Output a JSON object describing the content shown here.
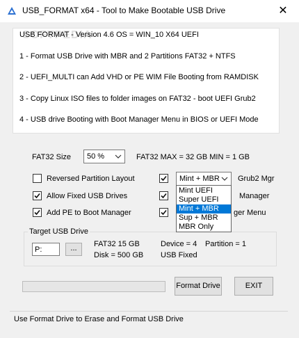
{
  "window": {
    "title": "USB_FORMAT x64 - Tool to Make Bootable USB Drive",
    "close_glyph": "✕"
  },
  "watermark": "SOFTPEDIA",
  "info": {
    "version_line": "USB FORMAT - Version 4.6    OS = WIN_10 X64  UEFI",
    "line1": "1 - Format USB Drive with MBR and 2 Partitions FAT32 + NTFS",
    "line2": "2 - UEFI_MULTI can Add VHD or PE WIM File Booting from RAMDISK",
    "line3": "3 - Copy Linux ISO files to folder images on FAT32 - boot UEFI Grub2",
    "line4": "4 - USB drive Booting with Boot Manager Menu in BIOS or UEFI Mode"
  },
  "fat32": {
    "label": "FAT32  Size",
    "value": "50 %",
    "info": "FAT32   MAX = 32 GB   MIN = 1 GB"
  },
  "options": {
    "reversed": "Reversed Partition Layout",
    "allow_fixed": "Allow Fixed USB Drives",
    "add_pe": "Add PE to Boot Manager",
    "grub_select": "Mint + MBR",
    "grub_label": "Grub2 Mgr",
    "hidden_label_2": "Manager",
    "hidden_label_3": "ger Menu",
    "states": {
      "reversed": false,
      "allow_fixed": true,
      "add_pe": true,
      "grub": true,
      "opt2": true,
      "opt3": true
    }
  },
  "dropdown_options": [
    "Mint   UEFI",
    "Super UEFI",
    "Mint + MBR",
    "Sup + MBR",
    "MBR  Only"
  ],
  "dropdown_selected_index": 2,
  "target": {
    "label": "Target USB Drive",
    "drive": "P:",
    "browse": "...",
    "fat32": "FAT32   15 GB",
    "disk": "Disk   =  500 GB",
    "device": "Device = 4",
    "partition": "Partition = 1",
    "bus": "USB   Fixed"
  },
  "buttons": {
    "format": "Format Drive",
    "exit": "EXIT"
  },
  "progress_fraction": 0,
  "status": "Use Format Drive to Erase and Format USB Drive",
  "colors": {
    "accent": "#0078d7",
    "panel": "#ffffff",
    "window": "#f0f0f0"
  }
}
